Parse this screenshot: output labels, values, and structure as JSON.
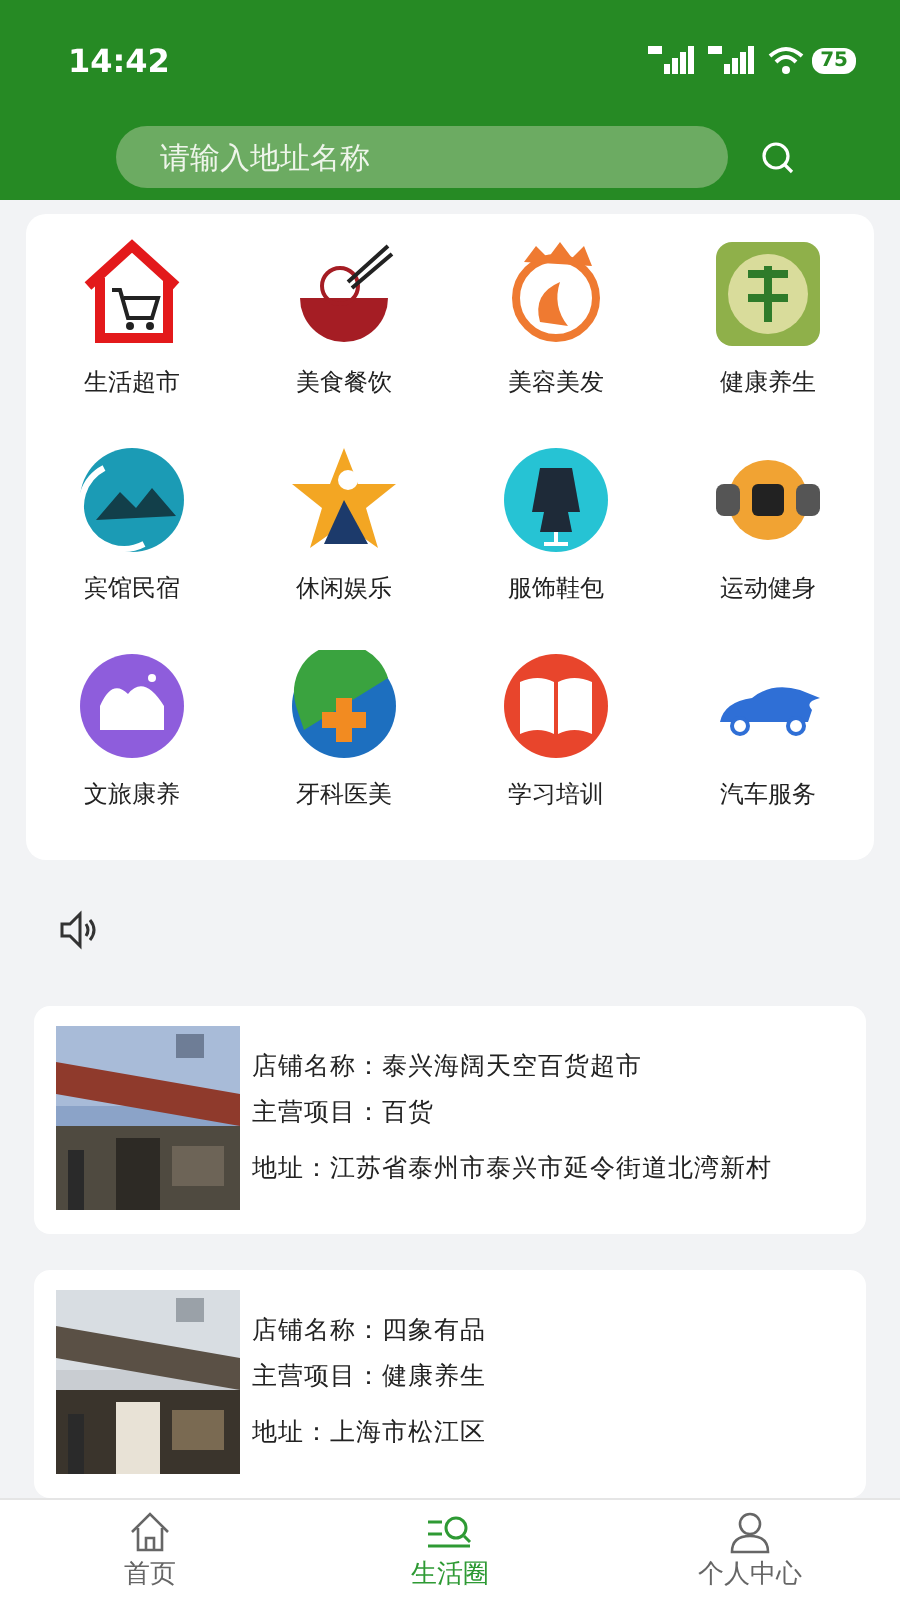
{
  "status_bar": {
    "time": "14:42",
    "battery": "75"
  },
  "search": {
    "placeholder": "请输入地址名称"
  },
  "categories": [
    {
      "label": "生活超市"
    },
    {
      "label": "美食餐饮"
    },
    {
      "label": "美容美发"
    },
    {
      "label": "健康养生"
    },
    {
      "label": "宾馆民宿"
    },
    {
      "label": "休闲娱乐"
    },
    {
      "label": "服饰鞋包"
    },
    {
      "label": "运动健身"
    },
    {
      "label": "文旅康养"
    },
    {
      "label": "牙科医美"
    },
    {
      "label": "学习培训"
    },
    {
      "label": "汽车服务"
    }
  ],
  "stores": [
    {
      "name": "店铺名称：泰兴海阔天空百货超市",
      "business": "主营项目：百货",
      "address": "地址：江苏省泰州市泰兴市延令街道北湾新村"
    },
    {
      "name": "店铺名称：四象有品",
      "business": "主营项目：健康养生",
      "address": "地址：上海市松江区"
    }
  ],
  "tabs": [
    {
      "label": "首页",
      "selected": false
    },
    {
      "label": "生活圈",
      "selected": true
    },
    {
      "label": "个人中心",
      "selected": false
    }
  ]
}
